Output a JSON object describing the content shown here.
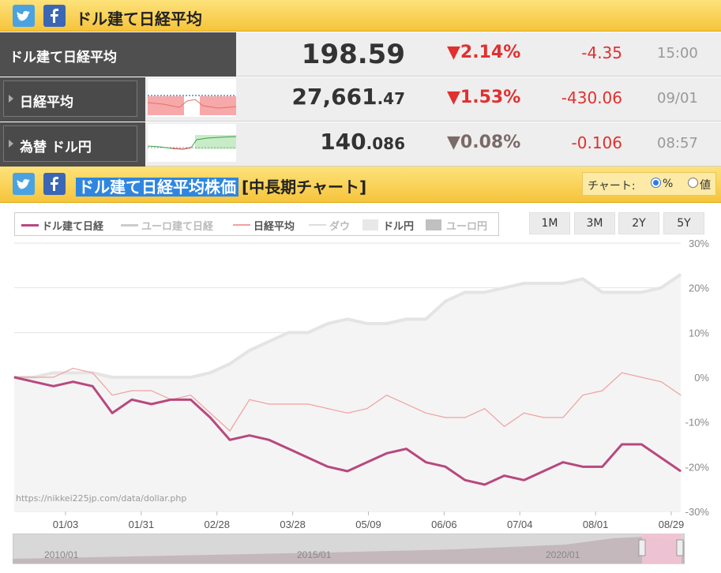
{
  "top_header": {
    "title": "ドル建て日経平均"
  },
  "rows": [
    {
      "label": "ドル建て日経平均",
      "value_main": "198.59",
      "value_dec": "",
      "pct": "▼2.14%",
      "change": "-4.35",
      "time": "15:00"
    },
    {
      "label": "日経平均",
      "value_main": "27,661",
      "value_dec": ".47",
      "pct": "▼1.53%",
      "change": "-430.06",
      "time": "09/01"
    },
    {
      "label": "為替 ドル円",
      "value_main": "140",
      "value_dec": ".086",
      "pct": "▼0.08%",
      "change": "-0.106",
      "time": "08:57"
    }
  ],
  "chart_header": {
    "title_selected": "ドル建て日経平均株価",
    "title_rest": "[中長期チャート]"
  },
  "mode": {
    "label": "チャート:",
    "opt1": "%",
    "opt2": "値"
  },
  "legend": [
    "ドル建て日経",
    "ユーロ建て日経",
    "日経平均",
    "ダウ",
    "ドル円",
    "ユーロ円"
  ],
  "ranges": [
    "1M",
    "3M",
    "2Y",
    "5Y"
  ],
  "source_text": "https://nikkei225jp.com/data/dollar.php",
  "navigator": {
    "labels": [
      "2010/01",
      "2015/01",
      "2020/01"
    ]
  },
  "colors": {
    "dollar_nikkei": "#b8487e",
    "nikkei": "#f0a0a0",
    "usdjpy": "#dddddd",
    "header": "#f8cf4f",
    "down_red": "#e03030"
  },
  "chart_data": {
    "type": "line",
    "x_ticks": [
      "01/03",
      "01/31",
      "02/28",
      "03/28",
      "05/09",
      "06/06",
      "07/04",
      "08/01",
      "08/29"
    ],
    "y_ticks": [
      "30%",
      "20%",
      "10%",
      "0%",
      "-10%",
      "-20%",
      "-30%"
    ],
    "ylim": [
      -30,
      30
    ],
    "series": [
      {
        "name": "ドル建て日経",
        "values": [
          0,
          -1,
          -2,
          -1,
          -2,
          -8,
          -5,
          -6,
          -5,
          -5,
          -9,
          -14,
          -13,
          -14,
          -16,
          -18,
          -20,
          -21,
          -19,
          -17,
          -16,
          -19,
          -20,
          -23,
          -24,
          -22,
          -23,
          -21,
          -19,
          -20,
          -20,
          -15,
          -15,
          -18,
          -21
        ]
      },
      {
        "name": "日経平均",
        "values": [
          0,
          0,
          0,
          2,
          1,
          -4,
          -3,
          -3,
          -5,
          -4,
          -8,
          -12,
          -5,
          -6,
          -6,
          -6,
          -7,
          -8,
          -7,
          -4,
          -6,
          -8,
          -9,
          -9,
          -7,
          -11,
          -8,
          -9,
          -9,
          -4,
          -3,
          1,
          0,
          -1,
          -4
        ]
      },
      {
        "name": "ドル円",
        "values": [
          0,
          0,
          1,
          1,
          1,
          0,
          0,
          0,
          0,
          0,
          1,
          3,
          6,
          8,
          10,
          10,
          12,
          13,
          12,
          12,
          13,
          13,
          17,
          19,
          19,
          20,
          21,
          21,
          21,
          22,
          19,
          19,
          19,
          20,
          23
        ]
      }
    ]
  }
}
